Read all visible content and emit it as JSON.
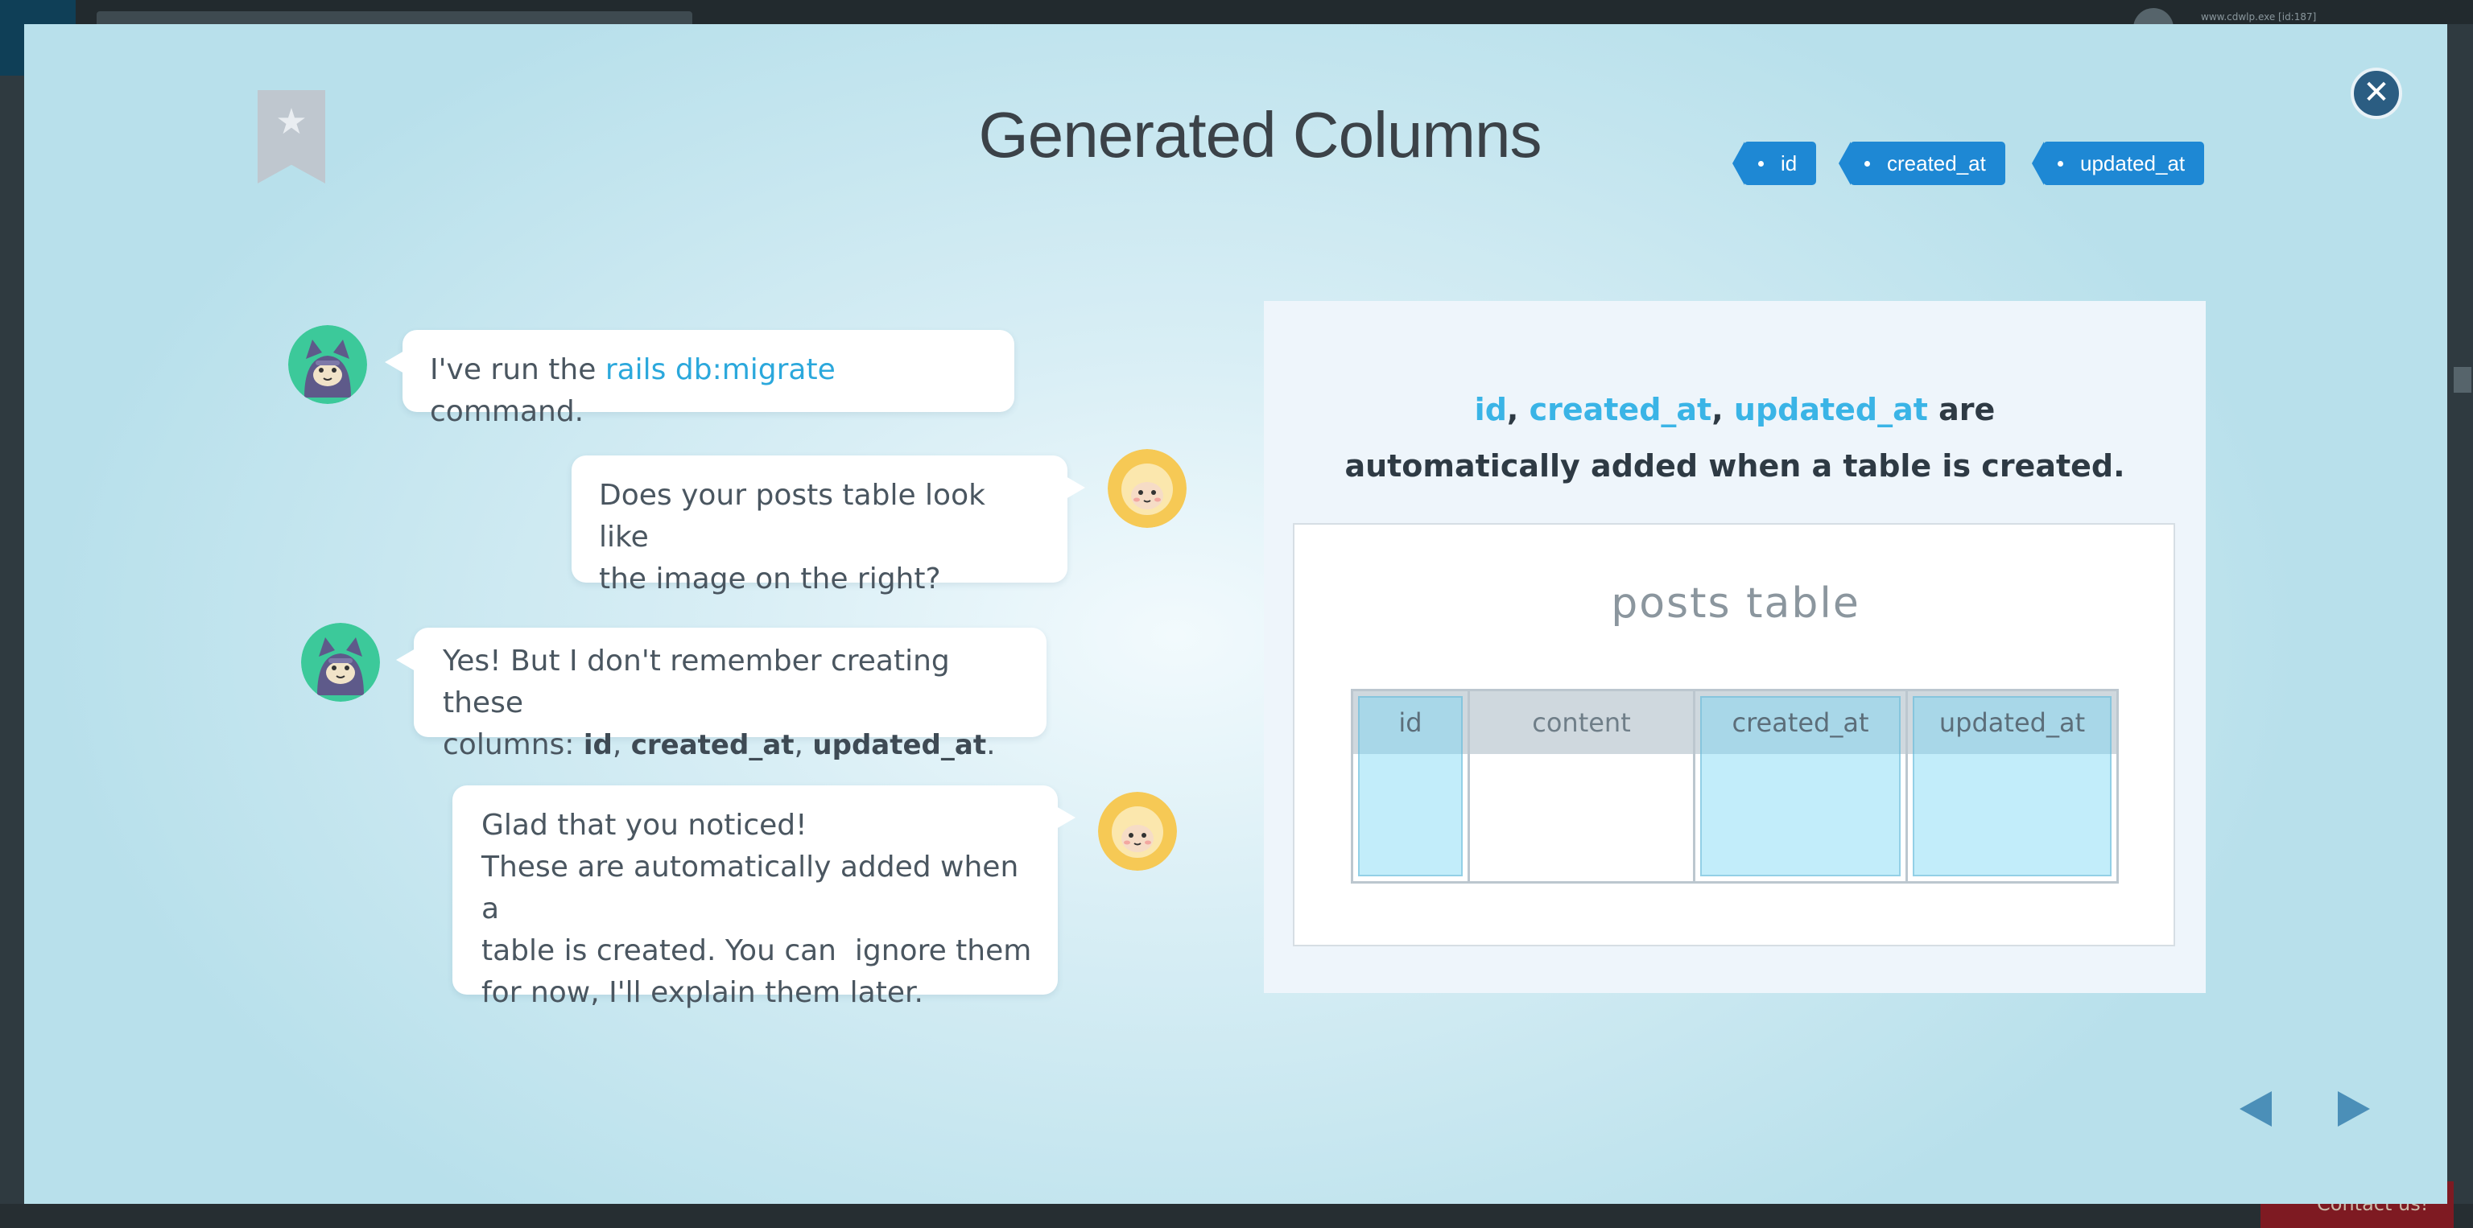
{
  "background": {
    "status_text": "www.cdwlp.exe [id:187]",
    "contact_label": "Contact us!"
  },
  "modal": {
    "title": "Generated Columns",
    "tags": [
      "id",
      "created_at",
      "updated_at"
    ],
    "close_icon": "close-icon"
  },
  "chat": [
    {
      "speaker": "cat",
      "side": "left",
      "segments": [
        {
          "text": "I've run the ",
          "style": "normal"
        },
        {
          "text": "rails db:migrate",
          "style": "highlight"
        },
        {
          "text": " command.",
          "style": "normal"
        }
      ]
    },
    {
      "speaker": "sheep",
      "side": "right",
      "segments": [
        {
          "text": "Does your posts table look like",
          "style": "normal"
        },
        {
          "text": "the image on the right?",
          "style": "normal"
        }
      ]
    },
    {
      "speaker": "cat",
      "side": "left",
      "segments": [
        {
          "text": "Yes! But I don't remember creating these",
          "style": "normal"
        },
        {
          "text": "columns: ",
          "style": "normal"
        },
        {
          "text": "id",
          "style": "code"
        },
        {
          "text": ", ",
          "style": "normal"
        },
        {
          "text": "created_at",
          "style": "code"
        },
        {
          "text": ", ",
          "style": "normal"
        },
        {
          "text": "updated_at",
          "style": "code"
        },
        {
          "text": ".",
          "style": "normal"
        }
      ]
    },
    {
      "speaker": "sheep",
      "side": "right",
      "segments": [
        {
          "text": "Glad that you noticed!",
          "style": "normal"
        },
        {
          "text": "These are automatically added when a",
          "style": "normal"
        },
        {
          "text": "table is created. You can  ignore them",
          "style": "normal"
        },
        {
          "text": "for now, I'll explain them later.",
          "style": "normal"
        }
      ]
    }
  ],
  "panel": {
    "headline_cols": [
      "id",
      "created_at",
      "updated_at"
    ],
    "headline_sep": ", ",
    "headline_are": " are",
    "headline_line2": "automatically added when a table is created.",
    "table_title": "posts table",
    "columns": [
      {
        "name": "id",
        "generated": true
      },
      {
        "name": "content",
        "generated": false
      },
      {
        "name": "created_at",
        "generated": true
      },
      {
        "name": "updated_at",
        "generated": true
      }
    ]
  },
  "nav": {
    "prev_icon": "arrow-left-icon",
    "next_icon": "arrow-right-icon"
  },
  "colors": {
    "accent": "#2ba8dc",
    "tag_blue": "#1e88d4",
    "close_blue": "#2b5d82",
    "nav_blue": "#4b8fb8",
    "cat_bg": "#3cc99a",
    "sheep_bg": "#f6c955"
  }
}
